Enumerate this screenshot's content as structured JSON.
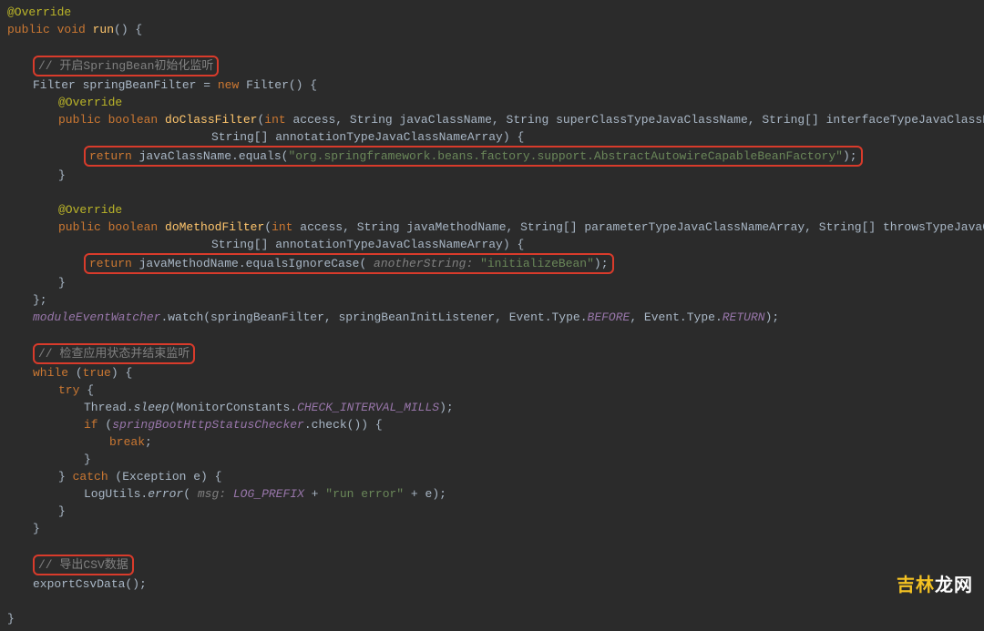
{
  "code": {
    "l01": "@Override",
    "l02a": "public void ",
    "l02b": "run",
    "l02c": "() {",
    "blank": " ",
    "c1": "// 开启SpringBean初始化监听",
    "l04a": "Filter springBeanFilter = ",
    "l04b": "new ",
    "l04c": "Filter() {",
    "l05": "@Override",
    "l06a": "public boolean ",
    "l06b": "doClassFilter",
    "l06c": "(",
    "l06d": "int ",
    "l06e": "access, String javaClassName, String superClassTypeJavaClassName, String[] interfaceTypeJavaClassNameArray,",
    "l07": "String[] annotationTypeJavaClassNameArray) {",
    "l08a": "return ",
    "l08b": "javaClassName.equals(",
    "l08c": "\"org.springframework.beans.factory.support.AbstractAutowireCapableBeanFactory\"",
    "l08d": ");",
    "l09": "}",
    "l10": "@Override",
    "l11a": "public boolean ",
    "l11b": "doMethodFilter",
    "l11c": "(",
    "l11d": "int ",
    "l11e": "access, String javaMethodName, String[] parameterTypeJavaClassNameArray, String[] throwsTypeJavaClassNameArray,",
    "l12": "String[] annotationTypeJavaClassNameArray) {",
    "l13a": "return ",
    "l13b": "javaMethodName.equalsIgnoreCase(",
    "l13h": " anotherString: ",
    "l13c": "\"initializeBean\"",
    "l13d": ");",
    "l14": "}",
    "l15": "};",
    "l16a": "moduleEventWatcher",
    "l16b": ".watch(springBeanFilter, springBeanInitListener, Event.Type.",
    "l16c": "BEFORE",
    "l16d": ", Event.Type.",
    "l16e": "RETURN",
    "l16f": ");",
    "c2": "// 检查应用状态并结束监听",
    "l18a": "while ",
    "l18b": "(",
    "l18c": "true",
    "l18d": ") {",
    "l19a": "try ",
    "l19b": "{",
    "l20a": "Thread.",
    "l20b": "sleep",
    "l20c": "(MonitorConstants.",
    "l20d": "CHECK_INTERVAL_MILLS",
    "l20e": ");",
    "l21a": "if ",
    "l21b": "(",
    "l21c": "springBootHttpStatusChecker",
    "l21d": ".check()) {",
    "l22a": "break",
    "l22b": ";",
    "l23": "}",
    "l24a": "} ",
    "l24b": "catch ",
    "l24c": "(Exception e) {",
    "l25a": "LogUtils.",
    "l25b": "error",
    "l25c": "(",
    "l25h": " msg: ",
    "l25d": "LOG_PREFIX",
    "l25e": " + ",
    "l25f": "\"run error\"",
    "l25g": " + e);",
    "l26": "}",
    "l27": "}",
    "c3": "// 导出CSV数据",
    "l29": "exportCsvData();",
    "l30": "}"
  },
  "watermark": {
    "part1": "吉林",
    "part2": "龙网"
  }
}
